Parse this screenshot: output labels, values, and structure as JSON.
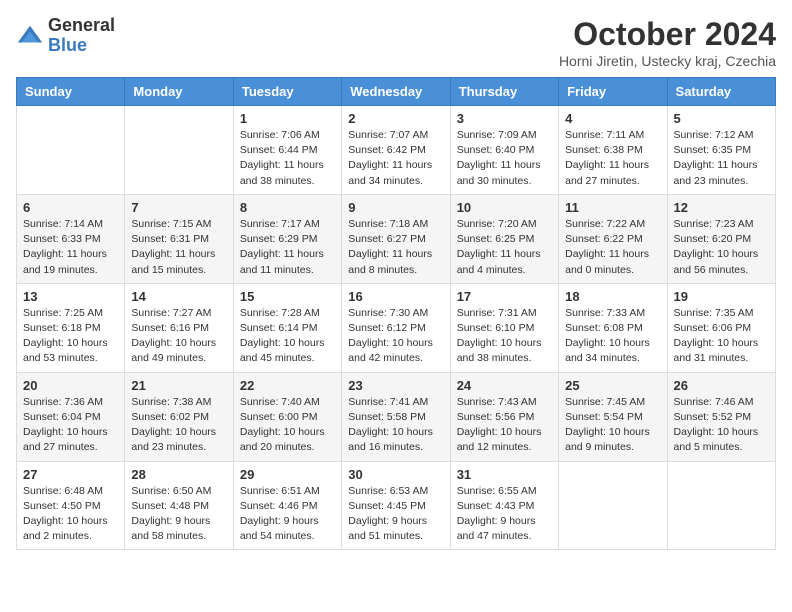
{
  "header": {
    "logo_line1": "General",
    "logo_line2": "Blue",
    "month": "October 2024",
    "location": "Horni Jiretin, Ustecky kraj, Czechia"
  },
  "weekdays": [
    "Sunday",
    "Monday",
    "Tuesday",
    "Wednesday",
    "Thursday",
    "Friday",
    "Saturday"
  ],
  "weeks": [
    [
      {
        "day": "",
        "info": ""
      },
      {
        "day": "",
        "info": ""
      },
      {
        "day": "1",
        "info": "Sunrise: 7:06 AM\nSunset: 6:44 PM\nDaylight: 11 hours and 38 minutes."
      },
      {
        "day": "2",
        "info": "Sunrise: 7:07 AM\nSunset: 6:42 PM\nDaylight: 11 hours and 34 minutes."
      },
      {
        "day": "3",
        "info": "Sunrise: 7:09 AM\nSunset: 6:40 PM\nDaylight: 11 hours and 30 minutes."
      },
      {
        "day": "4",
        "info": "Sunrise: 7:11 AM\nSunset: 6:38 PM\nDaylight: 11 hours and 27 minutes."
      },
      {
        "day": "5",
        "info": "Sunrise: 7:12 AM\nSunset: 6:35 PM\nDaylight: 11 hours and 23 minutes."
      }
    ],
    [
      {
        "day": "6",
        "info": "Sunrise: 7:14 AM\nSunset: 6:33 PM\nDaylight: 11 hours and 19 minutes."
      },
      {
        "day": "7",
        "info": "Sunrise: 7:15 AM\nSunset: 6:31 PM\nDaylight: 11 hours and 15 minutes."
      },
      {
        "day": "8",
        "info": "Sunrise: 7:17 AM\nSunset: 6:29 PM\nDaylight: 11 hours and 11 minutes."
      },
      {
        "day": "9",
        "info": "Sunrise: 7:18 AM\nSunset: 6:27 PM\nDaylight: 11 hours and 8 minutes."
      },
      {
        "day": "10",
        "info": "Sunrise: 7:20 AM\nSunset: 6:25 PM\nDaylight: 11 hours and 4 minutes."
      },
      {
        "day": "11",
        "info": "Sunrise: 7:22 AM\nSunset: 6:22 PM\nDaylight: 11 hours and 0 minutes."
      },
      {
        "day": "12",
        "info": "Sunrise: 7:23 AM\nSunset: 6:20 PM\nDaylight: 10 hours and 56 minutes."
      }
    ],
    [
      {
        "day": "13",
        "info": "Sunrise: 7:25 AM\nSunset: 6:18 PM\nDaylight: 10 hours and 53 minutes."
      },
      {
        "day": "14",
        "info": "Sunrise: 7:27 AM\nSunset: 6:16 PM\nDaylight: 10 hours and 49 minutes."
      },
      {
        "day": "15",
        "info": "Sunrise: 7:28 AM\nSunset: 6:14 PM\nDaylight: 10 hours and 45 minutes."
      },
      {
        "day": "16",
        "info": "Sunrise: 7:30 AM\nSunset: 6:12 PM\nDaylight: 10 hours and 42 minutes."
      },
      {
        "day": "17",
        "info": "Sunrise: 7:31 AM\nSunset: 6:10 PM\nDaylight: 10 hours and 38 minutes."
      },
      {
        "day": "18",
        "info": "Sunrise: 7:33 AM\nSunset: 6:08 PM\nDaylight: 10 hours and 34 minutes."
      },
      {
        "day": "19",
        "info": "Sunrise: 7:35 AM\nSunset: 6:06 PM\nDaylight: 10 hours and 31 minutes."
      }
    ],
    [
      {
        "day": "20",
        "info": "Sunrise: 7:36 AM\nSunset: 6:04 PM\nDaylight: 10 hours and 27 minutes."
      },
      {
        "day": "21",
        "info": "Sunrise: 7:38 AM\nSunset: 6:02 PM\nDaylight: 10 hours and 23 minutes."
      },
      {
        "day": "22",
        "info": "Sunrise: 7:40 AM\nSunset: 6:00 PM\nDaylight: 10 hours and 20 minutes."
      },
      {
        "day": "23",
        "info": "Sunrise: 7:41 AM\nSunset: 5:58 PM\nDaylight: 10 hours and 16 minutes."
      },
      {
        "day": "24",
        "info": "Sunrise: 7:43 AM\nSunset: 5:56 PM\nDaylight: 10 hours and 12 minutes."
      },
      {
        "day": "25",
        "info": "Sunrise: 7:45 AM\nSunset: 5:54 PM\nDaylight: 10 hours and 9 minutes."
      },
      {
        "day": "26",
        "info": "Sunrise: 7:46 AM\nSunset: 5:52 PM\nDaylight: 10 hours and 5 minutes."
      }
    ],
    [
      {
        "day": "27",
        "info": "Sunrise: 6:48 AM\nSunset: 4:50 PM\nDaylight: 10 hours and 2 minutes."
      },
      {
        "day": "28",
        "info": "Sunrise: 6:50 AM\nSunset: 4:48 PM\nDaylight: 9 hours and 58 minutes."
      },
      {
        "day": "29",
        "info": "Sunrise: 6:51 AM\nSunset: 4:46 PM\nDaylight: 9 hours and 54 minutes."
      },
      {
        "day": "30",
        "info": "Sunrise: 6:53 AM\nSunset: 4:45 PM\nDaylight: 9 hours and 51 minutes."
      },
      {
        "day": "31",
        "info": "Sunrise: 6:55 AM\nSunset: 4:43 PM\nDaylight: 9 hours and 47 minutes."
      },
      {
        "day": "",
        "info": ""
      },
      {
        "day": "",
        "info": ""
      }
    ]
  ]
}
